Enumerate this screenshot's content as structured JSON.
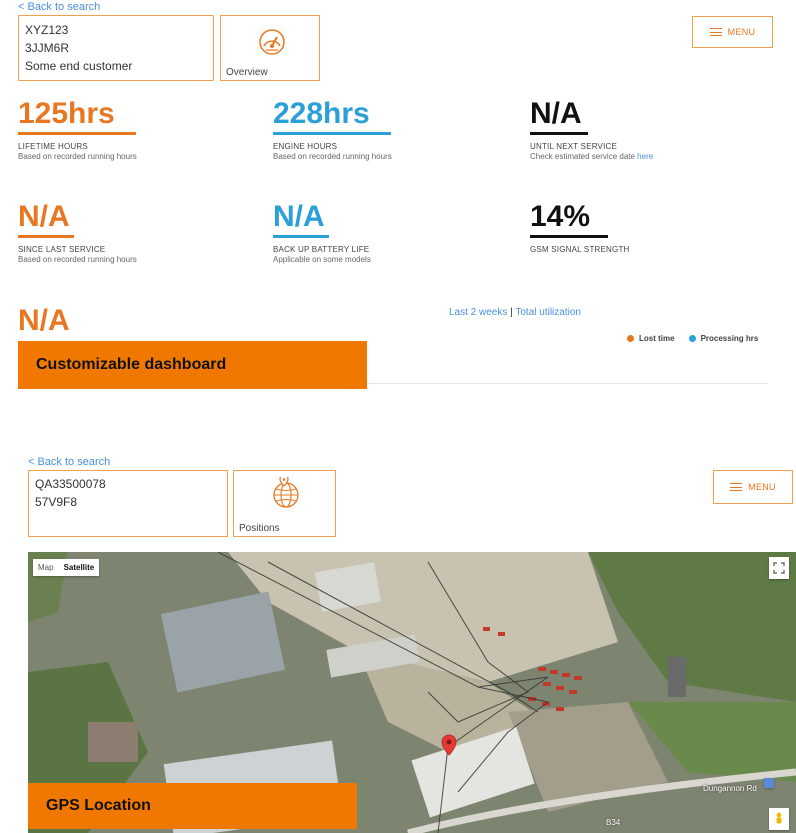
{
  "top": {
    "back_link": "< Back to search",
    "id_lines": [
      "XYZ123",
      "3JJM6R",
      "Some end customer"
    ],
    "nav_label": "Overview",
    "menu_label": "MENU"
  },
  "stats": [
    {
      "value": "125hrs",
      "label": "LIFETIME HOURS",
      "sub": "Based on recorded running hours",
      "color": "#e87722"
    },
    {
      "value": "228hrs",
      "label": "ENGINE HOURS",
      "sub": "Based on recorded running hours",
      "color": "#2a9fd8"
    },
    {
      "value": "N/A",
      "label": "UNTIL NEXT SERVICE",
      "sub": "Check estimated service date",
      "link": "here",
      "color": "#111111"
    },
    {
      "value": "N/A",
      "label": "SINCE LAST SERVICE",
      "sub": "Based on recorded running hours",
      "color": "#e87722"
    },
    {
      "value": "N/A",
      "label": "BACK UP BATTERY LIFE",
      "sub": "Applicable on some models",
      "color": "#2a9fd8"
    },
    {
      "value": "14%",
      "label": "GSM SIGNAL STRENGTH",
      "sub": "",
      "color": "#111111"
    },
    {
      "value": "N/A",
      "color": "#e87722"
    }
  ],
  "utilization": {
    "link_recent": "Last 2 weeks",
    "separator": "|",
    "link_total": "Total utilization",
    "legend": [
      {
        "name": "Lost time",
        "color": "#e87722"
      },
      {
        "name": "Processing hrs",
        "color": "#2a9fd8"
      }
    ]
  },
  "banners": {
    "dashboard": "Customizable dashboard",
    "gps": "GPS Location"
  },
  "bottom": {
    "back_link": "< Back to search",
    "id_lines": [
      "QA33500078",
      "57V9F8"
    ],
    "nav_label": "Positions",
    "menu_label": "MENU"
  },
  "map": {
    "type_map": "Map",
    "type_satellite": "Satellite",
    "road_dungannon": "Dungannon Rd",
    "road_b34": "B34"
  }
}
